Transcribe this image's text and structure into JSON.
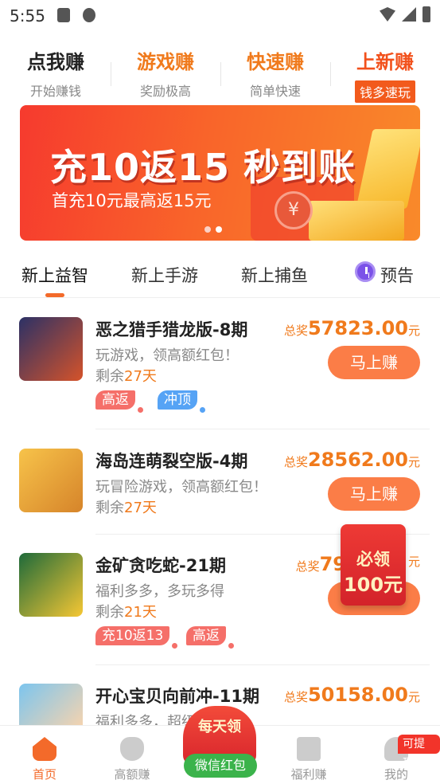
{
  "status": {
    "time": "5:55"
  },
  "topnav": [
    {
      "title": "点我赚",
      "subtitle": "开始赚钱"
    },
    {
      "title": "游戏赚",
      "subtitle": "奖励极高"
    },
    {
      "title": "快速赚",
      "subtitle": "简单快速"
    },
    {
      "title": "上新赚",
      "subtitle": "钱多速玩"
    }
  ],
  "banner": {
    "headline": "充10返15 秒到账",
    "subline": "首充10元最高返15元",
    "coin": "¥"
  },
  "tabs": [
    "新上益智",
    "新上手游",
    "新上捕鱼",
    "预告"
  ],
  "labels": {
    "prize_prefix": "总奖",
    "unit": "元",
    "left_prefix": "剩余",
    "button": "马上赚"
  },
  "games": [
    {
      "name": "恶之猎手猎龙版-8期",
      "desc": "玩游戏，领高额红包！",
      "left": "27天",
      "prize": "57823.00",
      "tags": [
        "高返",
        "冲顶"
      ]
    },
    {
      "name": "海岛连萌裂空版-4期",
      "desc": "玩冒险游戏，领高额红包！",
      "left": "27天",
      "prize": "28562.00",
      "tags": []
    },
    {
      "name": "金矿贪吃蛇-21期",
      "desc": "福利多多，多玩多得",
      "left": "21天",
      "prize": "79",
      "tags": [
        "充10返13",
        "高返"
      ]
    },
    {
      "name": "开心宝贝向前冲-11期",
      "desc": "福利多多，超级",
      "left": "",
      "prize": "50158.00",
      "tags": []
    }
  ],
  "float_red": {
    "line1": "必领",
    "line2": "100元"
  },
  "bottom": {
    "home": "首页",
    "high": "高额赚",
    "center_top": "每天领",
    "center_btn": "微信红包",
    "welfare": "福利赚",
    "mine": "我的",
    "badge": "可提现"
  }
}
